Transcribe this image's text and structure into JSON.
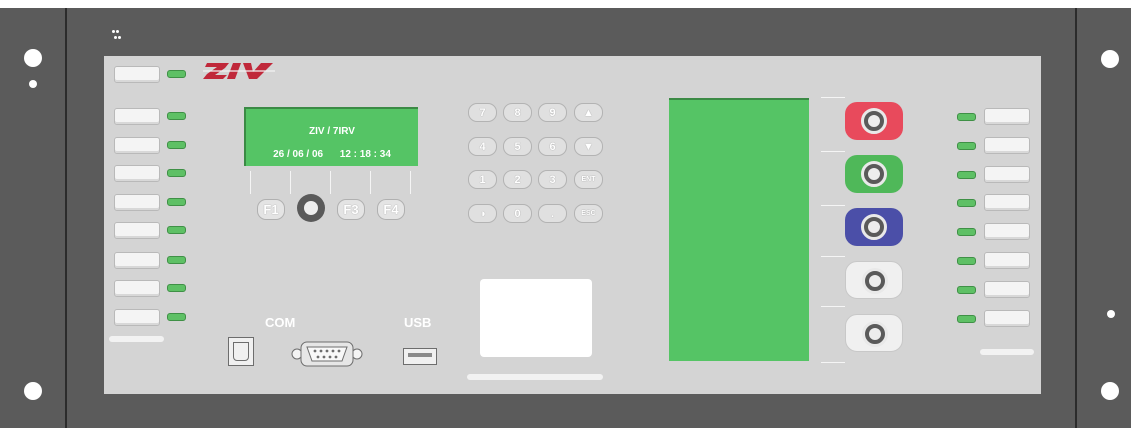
{
  "device": {
    "brand_logo": "ZIV",
    "colors": {
      "rack": "#5b5b5b",
      "panel": "#d4d4d4",
      "lcd": "#55c465",
      "led": "#5ec065",
      "logo": "#c0283a",
      "knob_red": "#e84a5c",
      "knob_green": "#4fb859",
      "knob_blue": "#4b4fa8",
      "knob_white": "#f0f0f0"
    }
  },
  "lcd": {
    "line1": "ZIV / 7IRV",
    "line2": "26 / 06 / 06      12 : 18 : 34"
  },
  "function_keys": {
    "f1": "F1",
    "f3": "F3",
    "f4": "F4"
  },
  "keypad": {
    "keys": [
      "7",
      "8",
      "9",
      "▲",
      "4",
      "5",
      "6",
      "▼",
      "1",
      "2",
      "3",
      "ENT",
      "◑",
      "0",
      ".",
      "ESC"
    ]
  },
  "ports": {
    "com_label": "COM",
    "usb_label": "USB"
  },
  "leds": {
    "left_count": 9,
    "right_count": 8
  }
}
